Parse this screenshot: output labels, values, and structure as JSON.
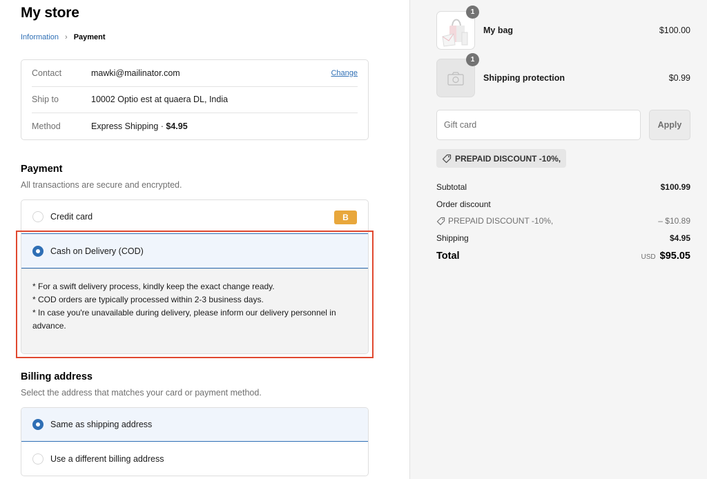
{
  "store": {
    "title": "My store"
  },
  "breadcrumb": {
    "items": [
      "Information",
      "Payment"
    ],
    "separator": "›"
  },
  "review": {
    "rows": [
      {
        "label": "Contact",
        "value": "mawki@mailinator.com",
        "action": "Change"
      },
      {
        "label": "Ship to",
        "value": "10002 Optio est at quaera DL, India"
      },
      {
        "label": "Method",
        "value": "Express Shipping · ",
        "value_bold": "$4.95"
      }
    ]
  },
  "payment": {
    "title": "Payment",
    "subtitle": "All transactions are secure and encrypted.",
    "options": [
      {
        "label": "Credit card",
        "selected": false,
        "badge": "B"
      },
      {
        "label": "Cash on Delivery (COD)",
        "selected": true
      }
    ],
    "cod_info": [
      "* For a swift delivery process, kindly keep the exact change ready.",
      "* COD orders are typically processed within 2-3 business days.",
      "* In case you're unavailable during delivery, please inform our delivery personnel in advance."
    ]
  },
  "billing": {
    "title": "Billing address",
    "subtitle": "Select the address that matches your card or payment method.",
    "options": [
      {
        "label": "Same as shipping address",
        "selected": true
      },
      {
        "label": "Use a different billing address",
        "selected": false
      }
    ]
  },
  "cart": {
    "items": [
      {
        "name": "My bag",
        "price": "$100.00",
        "qty": "1",
        "image": "handbag-image"
      },
      {
        "name": "Shipping protection",
        "price": "$0.99",
        "qty": "1",
        "image": "camera-placeholder-icon"
      }
    ],
    "gift_card": {
      "placeholder": "Gift card",
      "value": "",
      "apply_label": "Apply"
    },
    "discount_tag": "PREPAID DISCOUNT -10%,",
    "summary": {
      "subtotal_label": "Subtotal",
      "subtotal": "$100.99",
      "order_discount_label": "Order discount",
      "discount_code": "PREPAID DISCOUNT -10%,",
      "discount_amount": "– $10.89",
      "shipping_label": "Shipping",
      "shipping": "$4.95",
      "total_label": "Total",
      "currency": "USD",
      "total": "$95.05"
    }
  },
  "colors": {
    "accent": "#2f6fb5",
    "highlight": "#e0482f",
    "badge": "#e8a73c"
  }
}
